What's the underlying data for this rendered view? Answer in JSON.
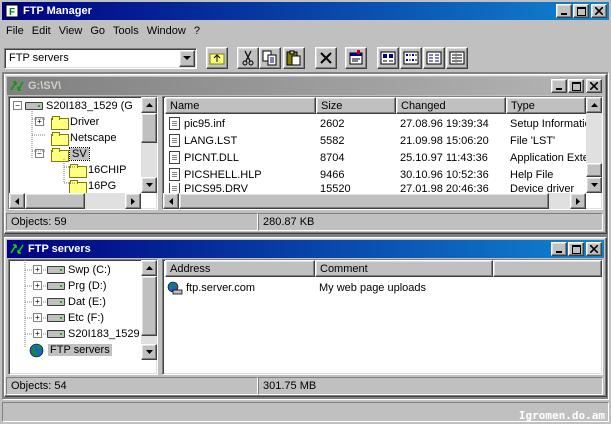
{
  "app": {
    "title": "FTP Manager",
    "min": "_",
    "max": "□",
    "close": "✕"
  },
  "menu": [
    "File",
    "Edit",
    "View",
    "Go",
    "Tools",
    "Window",
    "?"
  ],
  "toolbar": {
    "combo_value": "FTP servers",
    "buttons": [
      "up-folder-icon",
      "cut-icon",
      "copy-icon",
      "paste-icon",
      "delete-icon",
      "properties-icon",
      "large-icons-icon",
      "small-icons-icon",
      "list-icon",
      "details-icon"
    ]
  },
  "win1": {
    "title": "G:\\SV\\",
    "tree": [
      {
        "label": "S20I183_1529 (G",
        "type": "drive",
        "expander": "-"
      },
      {
        "label": "Driver",
        "type": "folder",
        "expander": "+"
      },
      {
        "label": "Netscape",
        "type": "folder",
        "expander": ""
      },
      {
        "label": "SV",
        "type": "folder",
        "expander": "-"
      },
      {
        "label": "16CHIP",
        "type": "folder",
        "expander": ""
      },
      {
        "label": "16PG",
        "type": "folder",
        "expander": ""
      }
    ],
    "columns": [
      "Name",
      "Size",
      "Changed",
      "Type"
    ],
    "rows": [
      [
        "pic95.inf",
        "2602",
        "27.08.96  19:39:34",
        "Setup Informatic"
      ],
      [
        "LANG.LST",
        "5582",
        "21.09.98  15:06:20",
        "File 'LST'"
      ],
      [
        "PICNT.DLL",
        "8704",
        "25.10.97  11:43:36",
        "Application Exte"
      ],
      [
        "PICSHELL.HLP",
        "9466",
        "30.10.96  10:52:36",
        "Help File"
      ],
      [
        "PICS95.DRV",
        "15520",
        "27.01.98  20:46:36",
        "Device driver"
      ]
    ],
    "status_objects": "Objects: 59",
    "status_size": "280.87 KB"
  },
  "win2": {
    "title": "FTP servers",
    "tree": [
      {
        "label": "Swp (C:)",
        "expander": "+"
      },
      {
        "label": "Prg (D:)",
        "expander": "+"
      },
      {
        "label": "Dat (E:)",
        "expander": "+"
      },
      {
        "label": "Etc (F:)",
        "expander": "+"
      },
      {
        "label": "S20I183_1529",
        "expander": "+"
      },
      {
        "label": "FTP servers",
        "expander": ""
      }
    ],
    "columns": [
      "Address",
      "Comment"
    ],
    "rows": [
      [
        "ftp.server.com",
        "My web page uploads"
      ]
    ],
    "status_objects": "Objects: 54",
    "status_size": "301.75 MB"
  },
  "watermark": "Igromen.do.am"
}
